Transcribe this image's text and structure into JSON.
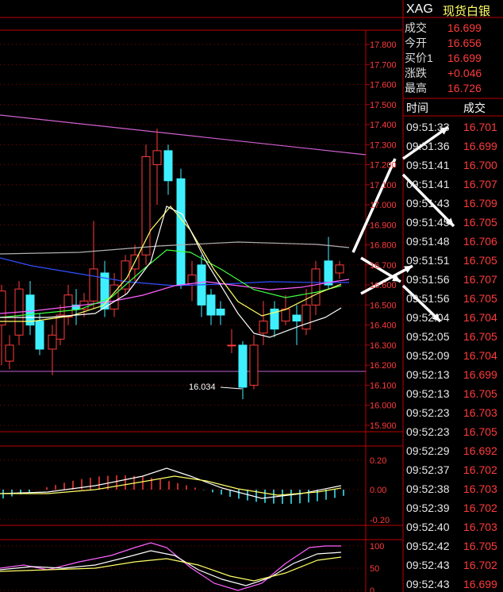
{
  "header": {
    "symbol": "XAG",
    "name": "现货白银"
  },
  "quote": [
    {
      "label": "成交",
      "value": "16.699"
    },
    {
      "label": "今开",
      "value": "16.656"
    },
    {
      "label": "买价1",
      "value": "16.699"
    },
    {
      "label": "涨跌",
      "value": "+0.046"
    },
    {
      "label": "最高",
      "value": "16.726"
    }
  ],
  "ticks_header": {
    "time": "时间",
    "price": "成交"
  },
  "ticks": [
    {
      "time": "09:51:33",
      "price": "16.701"
    },
    {
      "time": "09:51:36",
      "price": "16.699"
    },
    {
      "time": "09:51:41",
      "price": "16.700"
    },
    {
      "time": "09:51:41",
      "price": "16.707"
    },
    {
      "time": "09:51:43",
      "price": "16.709"
    },
    {
      "time": "09:51:45",
      "price": "16.705"
    },
    {
      "time": "09:51:48",
      "price": "16.706"
    },
    {
      "time": "09:51:51",
      "price": "16.705"
    },
    {
      "time": "09:51:56",
      "price": "16.707"
    },
    {
      "time": "09:51:56",
      "price": "16.705"
    },
    {
      "time": "09:52:04",
      "price": "16.704"
    },
    {
      "time": "09:52:05",
      "price": "16.705"
    },
    {
      "time": "09:52:09",
      "price": "16.704"
    },
    {
      "time": "09:52:13",
      "price": "16.699"
    },
    {
      "time": "09:52:13",
      "price": "16.705"
    },
    {
      "time": "09:52:23",
      "price": "16.703"
    },
    {
      "time": "09:52:23",
      "price": "16.705"
    },
    {
      "time": "09:52:29",
      "price": "16.692"
    },
    {
      "time": "09:52:37",
      "price": "16.702"
    },
    {
      "time": "09:52:38",
      "price": "16.703"
    },
    {
      "time": "09:52:39",
      "price": "16.702"
    },
    {
      "time": "09:52:40",
      "price": "16.703"
    },
    {
      "time": "09:52:42",
      "price": "16.705"
    },
    {
      "time": "09:52:43",
      "price": "16.702"
    },
    {
      "time": "09:52:43",
      "price": "16.699"
    }
  ],
  "price_axis": [
    "17.800",
    "17.700",
    "17.600",
    "17.500",
    "17.400",
    "17.300",
    "17.200",
    "17.100",
    "17.000",
    "16.900",
    "16.800",
    "16.700",
    "16.600",
    "16.500",
    "16.400",
    "16.300",
    "16.200",
    "16.100",
    "16.000",
    "15.900"
  ],
  "low_label": "16.034",
  "macd_axis": [
    "0.20",
    "0.00",
    "-0.20"
  ],
  "kdj_axis": [
    "100",
    "50",
    "0"
  ],
  "colors": {
    "up": "#ff3b3b",
    "down": "#3ef0ff",
    "accent": "#ffff66"
  }
}
